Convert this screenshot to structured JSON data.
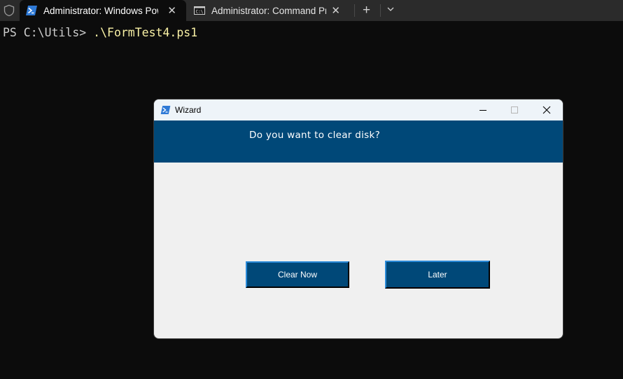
{
  "tabbar": {
    "tabs": [
      {
        "label": "Administrator: Windows PowerShell",
        "icon": "powershell-icon",
        "active": true,
        "close": "✕"
      },
      {
        "label": "Administrator: Command Prompt",
        "icon": "cmd-icon",
        "active": false,
        "close": "✕"
      }
    ],
    "new_tab": "+",
    "dropdown": "chevron-down-icon"
  },
  "terminal": {
    "prompt": "PS C:\\Utils> ",
    "command": ".\\FormTest4.ps1"
  },
  "wizard": {
    "title": "Wizard",
    "question": "Do you want to clear disk?",
    "buttons": {
      "clear": "Clear Now",
      "later": "Later"
    },
    "colors": {
      "header": "#004878",
      "button": "#004878",
      "body": "#f0f0f0"
    }
  }
}
